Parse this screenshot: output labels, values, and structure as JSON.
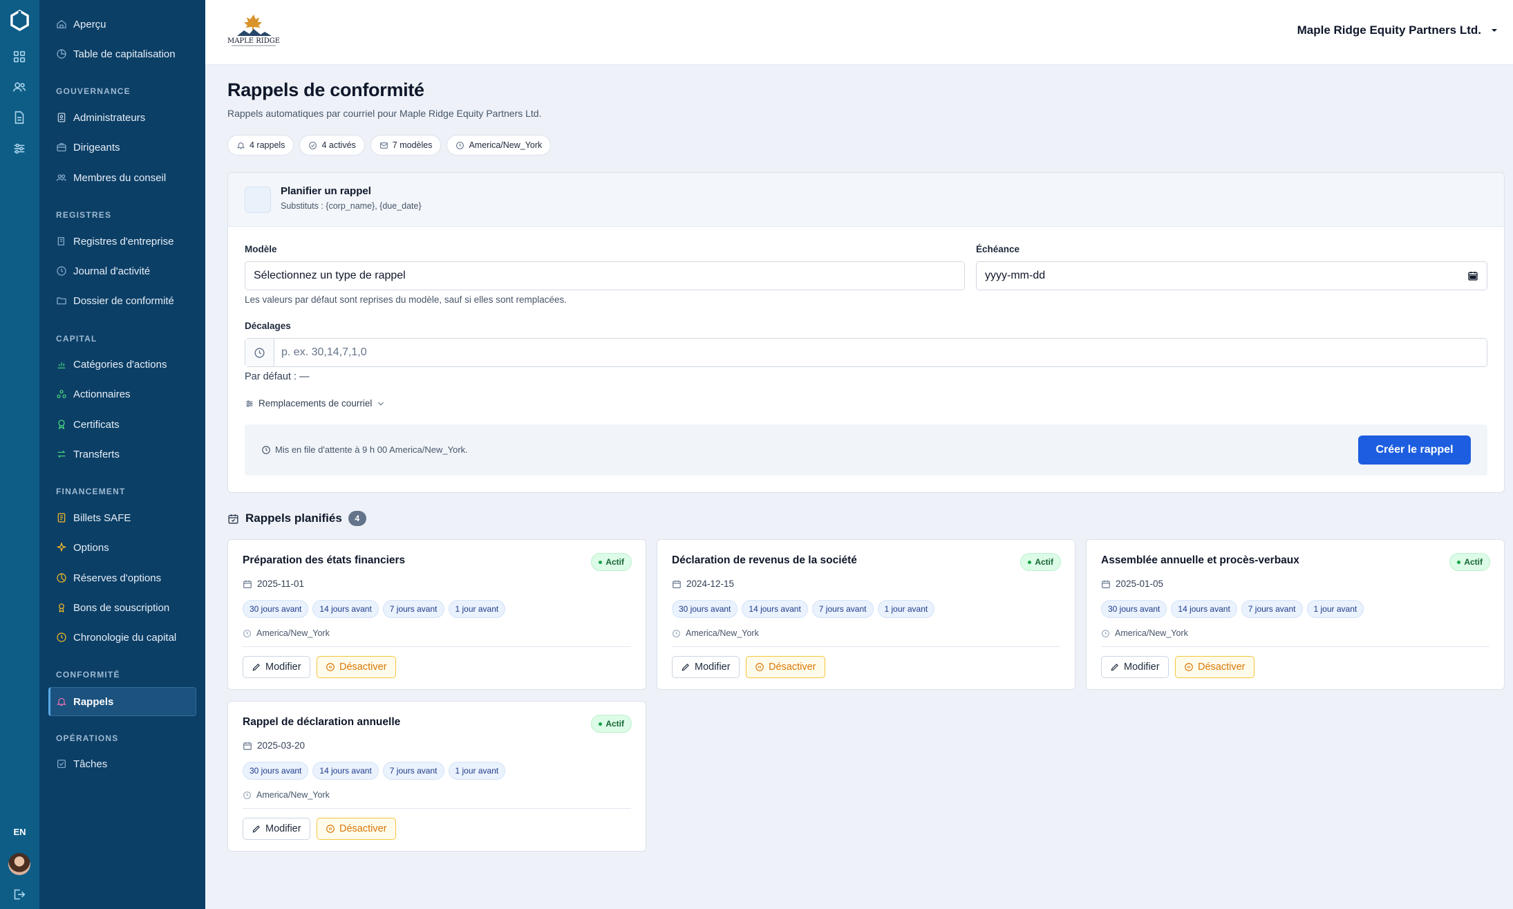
{
  "rail": {
    "language": "EN"
  },
  "sidebar": {
    "top_items": [
      {
        "label": "Aperçu"
      },
      {
        "label": "Table de capitalisation"
      }
    ],
    "sections": [
      {
        "title": "GOUVERNANCE",
        "items": [
          {
            "label": "Administrateurs"
          },
          {
            "label": "Dirigeants"
          },
          {
            "label": "Membres du conseil"
          }
        ]
      },
      {
        "title": "REGISTRES",
        "items": [
          {
            "label": "Registres d'entreprise"
          },
          {
            "label": "Journal d'activité"
          },
          {
            "label": "Dossier de conformité"
          }
        ]
      },
      {
        "title": "CAPITAL",
        "items": [
          {
            "label": "Catégories d'actions"
          },
          {
            "label": "Actionnaires"
          },
          {
            "label": "Certificats"
          },
          {
            "label": "Transferts"
          }
        ]
      },
      {
        "title": "FINANCEMENT",
        "items": [
          {
            "label": "Billets SAFE"
          },
          {
            "label": "Options"
          },
          {
            "label": "Réserves d'options"
          },
          {
            "label": "Bons de souscription"
          },
          {
            "label": "Chronologie du capital"
          }
        ]
      },
      {
        "title": "CONFORMITÉ",
        "items": [
          {
            "label": "Rappels"
          }
        ]
      },
      {
        "title": "OPÉRATIONS",
        "items": [
          {
            "label": "Tâches"
          }
        ]
      }
    ],
    "active_item": "Rappels"
  },
  "header": {
    "brand_name": "MAPLE RIDGE",
    "company": "Maple Ridge Equity Partners Ltd."
  },
  "page": {
    "title": "Rappels de conformité",
    "subtitle": "Rappels automatiques par courriel pour Maple Ridge Equity Partners Ltd.",
    "chips": [
      {
        "icon": "bell-icon",
        "label": "4 rappels"
      },
      {
        "icon": "check-circle-icon",
        "label": "4 activés"
      },
      {
        "icon": "mail-icon",
        "label": "7 modèles"
      },
      {
        "icon": "clock-icon",
        "label": "America/New_York"
      }
    ]
  },
  "planner": {
    "title": "Planifier un rappel",
    "subtitle": "Substituts : {corp_name}, {due_date}",
    "template_label": "Modèle",
    "template_value": "Sélectionnez un type de rappel",
    "template_hint": "Les valeurs par défaut sont reprises du modèle, sauf si elles sont remplacées.",
    "due_label": "Échéance",
    "due_value": "yyyy-mm-dd",
    "offsets_label": "Décalages",
    "offsets_placeholder": "p. ex. 30,14,7,1,0",
    "default_text": "Par défaut : —",
    "overrides_label": "Remplacements de courriel",
    "queue_text": "Mis en file d'attente à 9 h 00 America/New_York.",
    "create_label": "Créer le rappel"
  },
  "scheduled": {
    "title": "Rappels planifiés",
    "count": "4",
    "modify_label": "Modifier",
    "deactivate_label": "Désactiver",
    "reminders": [
      {
        "title": "Préparation des états financiers",
        "status": "Actif",
        "date": "2025-11-01",
        "offsets": [
          "30 jours avant",
          "14 jours avant",
          "7 jours avant",
          "1 jour avant"
        ],
        "timezone": "America/New_York"
      },
      {
        "title": "Déclaration de revenus de la société",
        "status": "Actif",
        "date": "2024-12-15",
        "offsets": [
          "30 jours avant",
          "14 jours avant",
          "7 jours avant",
          "1 jour avant"
        ],
        "timezone": "America/New_York"
      },
      {
        "title": "Assemblée annuelle et procès-verbaux",
        "status": "Actif",
        "date": "2025-01-05",
        "offsets": [
          "30 jours avant",
          "14 jours avant",
          "7 jours avant",
          "1 jour avant"
        ],
        "timezone": "America/New_York"
      },
      {
        "title": "Rappel de déclaration annuelle",
        "status": "Actif",
        "date": "2025-03-20",
        "offsets": [
          "30 jours avant",
          "14 jours avant",
          "7 jours avant",
          "1 jour avant"
        ],
        "timezone": "America/New_York"
      }
    ]
  },
  "colors": {
    "rail": "#0d5d86",
    "sidebar": "#0c3f66",
    "primary": "#1d5ee0",
    "warning": "#d97706",
    "success": "#166534"
  }
}
